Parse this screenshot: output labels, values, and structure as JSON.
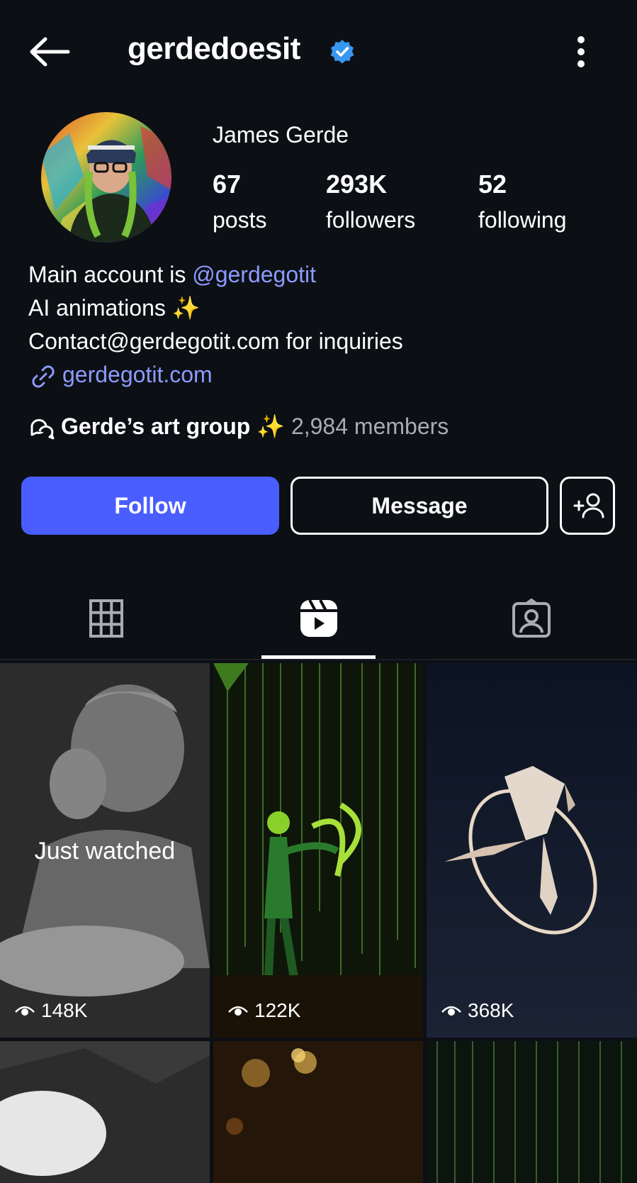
{
  "header": {
    "username": "gerdedoesit",
    "verified": true
  },
  "profile": {
    "display_name": "James Gerde",
    "stats": [
      {
        "value": "67",
        "label": "posts"
      },
      {
        "value": "293K",
        "label": "followers"
      },
      {
        "value": "52",
        "label": "following"
      }
    ],
    "bio": {
      "line1_prefix": "Main account is ",
      "line1_mention": "@gerdegotit",
      "line2": "AI animations ✨",
      "line3": "Contact@gerdegotit.com for inquiries",
      "link": "gerdegotit.com"
    },
    "group": {
      "name": "Gerde’s art group ✨",
      "members": "2,984 members"
    }
  },
  "actions": {
    "follow_label": "Follow",
    "message_label": "Message"
  },
  "tabs": [
    {
      "name": "grid",
      "icon": "grid-icon"
    },
    {
      "name": "reels",
      "icon": "reels-icon",
      "active": true
    },
    {
      "name": "tagged",
      "icon": "tagged-icon"
    }
  ],
  "reels": [
    {
      "views": "148K",
      "overlay": "Just watched"
    },
    {
      "views": "122K"
    },
    {
      "views": "368K"
    },
    {},
    {},
    {}
  ],
  "colors": {
    "background": "#0c0f14",
    "accent": "#4a5dff",
    "link": "#8c9bff",
    "verified": "#3897f0"
  }
}
